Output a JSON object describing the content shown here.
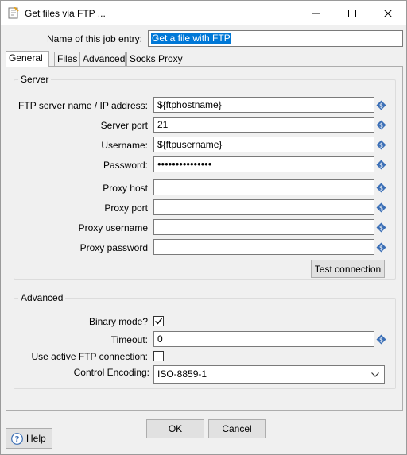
{
  "window": {
    "title": "Get files via FTP ...",
    "controls": {
      "minimize": "minimize",
      "maximize": "maximize",
      "close": "close"
    }
  },
  "job_entry": {
    "label": "Name of this job entry:",
    "value": "Get a file with FTP"
  },
  "tabs": [
    {
      "label": "General",
      "active": true
    },
    {
      "label": "Files",
      "active": false
    },
    {
      "label": "Advanced",
      "active": false
    },
    {
      "label": "Socks Proxy",
      "active": false
    }
  ],
  "server": {
    "group_title": "Server",
    "fields": [
      {
        "label": "FTP server name / IP address:",
        "value": "${ftphostname}"
      },
      {
        "label": "Server port",
        "value": "21"
      },
      {
        "label": "Username:",
        "value": "${ftpusername}"
      },
      {
        "label": "Password:",
        "value": "•••••••••••••••"
      },
      {
        "label": "Proxy host",
        "value": ""
      },
      {
        "label": "Proxy port",
        "value": ""
      },
      {
        "label": "Proxy username",
        "value": ""
      },
      {
        "label": "Proxy password",
        "value": ""
      }
    ],
    "test_button": "Test connection"
  },
  "advanced": {
    "group_title": "Advanced",
    "binary_mode_label": "Binary mode?",
    "binary_mode_checked": true,
    "timeout_label": "Timeout:",
    "timeout_value": "0",
    "active_ftp_label": "Use active FTP connection:",
    "active_ftp_checked": false,
    "encoding_label": "Control Encoding:",
    "encoding_value": "ISO-8859-1"
  },
  "footer": {
    "ok": "OK",
    "cancel": "Cancel",
    "help": "Help"
  },
  "colors": {
    "selection": "#0078d7",
    "variable_icon": "#3b6fb6"
  }
}
